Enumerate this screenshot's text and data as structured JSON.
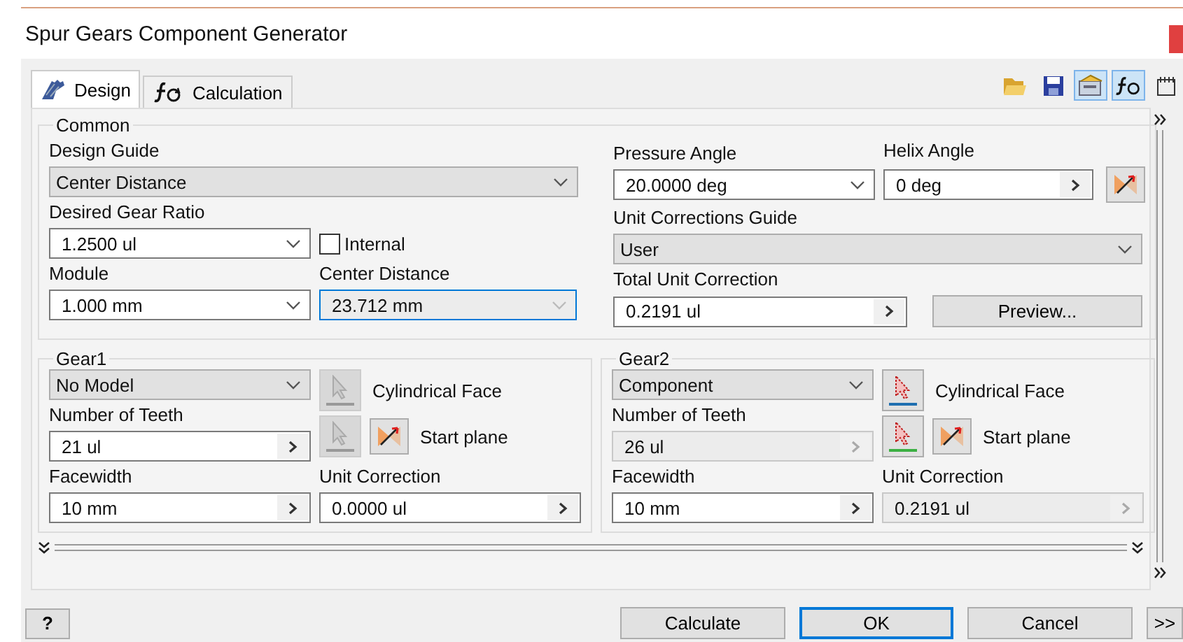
{
  "window": {
    "title": "Spur Gears Component Generator"
  },
  "tabs": [
    {
      "label": "Design",
      "selected": true
    },
    {
      "label": "Calculation",
      "selected": false
    }
  ],
  "toolbar": [
    {
      "kind": "folder",
      "selected": false
    },
    {
      "kind": "save",
      "selected": false
    },
    {
      "kind": "options",
      "selected": true
    },
    {
      "kind": "formula",
      "selected": true
    },
    {
      "kind": "notes",
      "selected": false
    }
  ],
  "common": {
    "title": "Common",
    "design_guide": {
      "label": "Design Guide",
      "value": "Center Distance",
      "kind": "select",
      "disabled": false
    },
    "gear_ratio": {
      "label": "Desired Gear Ratio",
      "value": "1.2500 ul",
      "kind": "dropdown",
      "disabled": false
    },
    "internal": {
      "label": "Internal",
      "checked": false
    },
    "module": {
      "label": "Module",
      "value": "1.000 mm",
      "kind": "dropdown",
      "disabled": false
    },
    "center_distance": {
      "label": "Center Distance",
      "value": "23.712 mm",
      "kind": "dropdown",
      "disabled": true
    },
    "pressure_angle": {
      "label": "Pressure Angle",
      "value": "20.0000 deg",
      "kind": "dropdown",
      "disabled": false
    },
    "helix_angle": {
      "label": "Helix Angle",
      "value": "0 deg",
      "kind": "spin",
      "disabled": false
    },
    "unit_corrections_guide": {
      "label": "Unit Corrections Guide",
      "value": "User",
      "kind": "select",
      "disabled": false
    },
    "total_unit_correction": {
      "label": "Total Unit Correction",
      "value": "0.2191 ul",
      "kind": "spin",
      "disabled": false
    },
    "preview_button": "Preview..."
  },
  "gears": [
    {
      "title": "Gear1",
      "model": {
        "value": "No Model",
        "kind": "select",
        "disabled": false
      },
      "teeth": {
        "label": "Number of Teeth",
        "value": "21 ul",
        "kind": "spin",
        "disabled": false
      },
      "facewidth": {
        "label": "Facewidth",
        "value": "10 mm",
        "kind": "spin",
        "disabled": false
      },
      "unit_correction": {
        "label": "Unit Correction",
        "value": "0.0000 ul",
        "kind": "spin",
        "disabled": false
      },
      "cylindrical_face": {
        "label": "Cylindrical Face",
        "enabled": false
      },
      "start_plane": {
        "label": "Start plane",
        "enabled": false
      }
    },
    {
      "title": "Gear2",
      "model": {
        "value": "Component",
        "kind": "select",
        "disabled": false
      },
      "teeth": {
        "label": "Number of Teeth",
        "value": "26 ul",
        "kind": "spin",
        "disabled": true
      },
      "facewidth": {
        "label": "Facewidth",
        "value": "10 mm",
        "kind": "spin",
        "disabled": false
      },
      "unit_correction": {
        "label": "Unit Correction",
        "value": "0.2191 ul",
        "kind": "spin",
        "disabled": true
      },
      "cylindrical_face": {
        "label": "Cylindrical Face",
        "enabled": true
      },
      "start_plane": {
        "label": "Start plane",
        "enabled": true
      }
    }
  ],
  "buttons": {
    "help": "?",
    "calculate": "Calculate",
    "ok": "OK",
    "cancel": "Cancel",
    "more": ">>"
  }
}
